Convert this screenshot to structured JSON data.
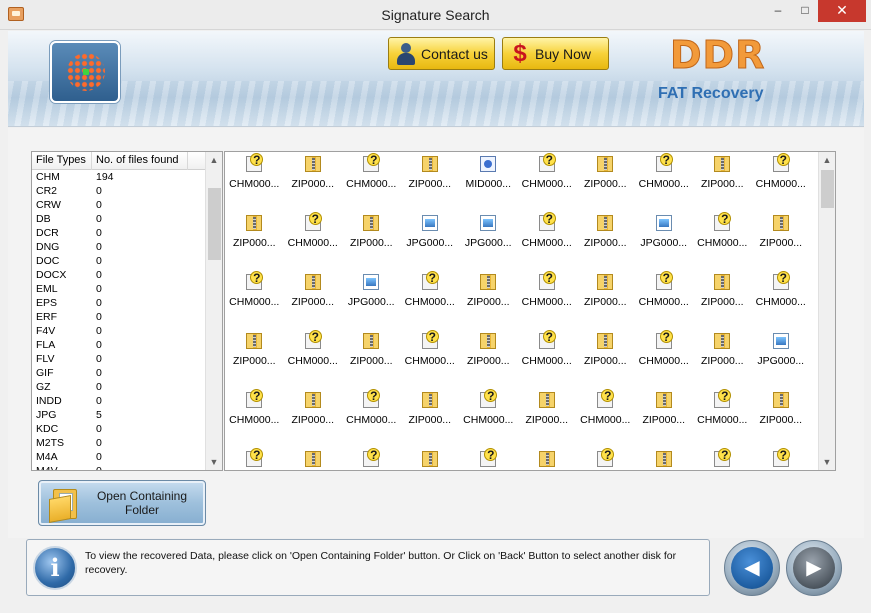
{
  "window": {
    "title": "Signature Search",
    "minimize": "–",
    "maximize": "□",
    "close": "✕"
  },
  "header": {
    "contact_label": "Contact us",
    "buy_label": "Buy  Now",
    "brand": "DDR",
    "brand_sub": "FAT Recovery"
  },
  "types_table": {
    "col1": "File Types",
    "col2": "No. of files found",
    "rows": [
      [
        "CHM",
        "194"
      ],
      [
        "CR2",
        "0"
      ],
      [
        "CRW",
        "0"
      ],
      [
        "DB",
        "0"
      ],
      [
        "DCR",
        "0"
      ],
      [
        "DNG",
        "0"
      ],
      [
        "DOC",
        "0"
      ],
      [
        "DOCX",
        "0"
      ],
      [
        "EML",
        "0"
      ],
      [
        "EPS",
        "0"
      ],
      [
        "ERF",
        "0"
      ],
      [
        "F4V",
        "0"
      ],
      [
        "FLA",
        "0"
      ],
      [
        "FLV",
        "0"
      ],
      [
        "GIF",
        "0"
      ],
      [
        "GZ",
        "0"
      ],
      [
        "INDD",
        "0"
      ],
      [
        "JPG",
        "5"
      ],
      [
        "KDC",
        "0"
      ],
      [
        "M2TS",
        "0"
      ],
      [
        "M4A",
        "0"
      ],
      [
        "M4V",
        "0"
      ]
    ]
  },
  "files": [
    {
      "t": "chm",
      "n": "CHM000..."
    },
    {
      "t": "zip",
      "n": "ZIP000..."
    },
    {
      "t": "chm",
      "n": "CHM000..."
    },
    {
      "t": "zip",
      "n": "ZIP000..."
    },
    {
      "t": "mid",
      "n": "MID000..."
    },
    {
      "t": "chm",
      "n": "CHM000..."
    },
    {
      "t": "zip",
      "n": "ZIP000..."
    },
    {
      "t": "chm",
      "n": "CHM000..."
    },
    {
      "t": "zip",
      "n": "ZIP000..."
    },
    {
      "t": "chm",
      "n": "CHM000..."
    },
    {
      "t": "zip",
      "n": "ZIP000..."
    },
    {
      "t": "chm",
      "n": "CHM000..."
    },
    {
      "t": "zip",
      "n": "ZIP000..."
    },
    {
      "t": "jpg",
      "n": "JPG000..."
    },
    {
      "t": "jpg",
      "n": "JPG000..."
    },
    {
      "t": "chm",
      "n": "CHM000..."
    },
    {
      "t": "zip",
      "n": "ZIP000..."
    },
    {
      "t": "jpg",
      "n": "JPG000..."
    },
    {
      "t": "chm",
      "n": "CHM000..."
    },
    {
      "t": "zip",
      "n": "ZIP000..."
    },
    {
      "t": "chm",
      "n": "CHM000..."
    },
    {
      "t": "zip",
      "n": "ZIP000..."
    },
    {
      "t": "jpg",
      "n": "JPG000..."
    },
    {
      "t": "chm",
      "n": "CHM000..."
    },
    {
      "t": "zip",
      "n": "ZIP000..."
    },
    {
      "t": "chm",
      "n": "CHM000..."
    },
    {
      "t": "zip",
      "n": "ZIP000..."
    },
    {
      "t": "chm",
      "n": "CHM000..."
    },
    {
      "t": "zip",
      "n": "ZIP000..."
    },
    {
      "t": "chm",
      "n": "CHM000..."
    },
    {
      "t": "zip",
      "n": "ZIP000..."
    },
    {
      "t": "chm",
      "n": "CHM000..."
    },
    {
      "t": "zip",
      "n": "ZIP000..."
    },
    {
      "t": "chm",
      "n": "CHM000..."
    },
    {
      "t": "zip",
      "n": "ZIP000..."
    },
    {
      "t": "chm",
      "n": "CHM000..."
    },
    {
      "t": "zip",
      "n": "ZIP000..."
    },
    {
      "t": "chm",
      "n": "CHM000..."
    },
    {
      "t": "zip",
      "n": "ZIP000..."
    },
    {
      "t": "jpg",
      "n": "JPG000..."
    },
    {
      "t": "chm",
      "n": "CHM000..."
    },
    {
      "t": "zip",
      "n": "ZIP000..."
    },
    {
      "t": "chm",
      "n": "CHM000..."
    },
    {
      "t": "zip",
      "n": "ZIP000..."
    },
    {
      "t": "chm",
      "n": "CHM000..."
    },
    {
      "t": "zip",
      "n": "ZIP000..."
    },
    {
      "t": "chm",
      "n": "CHM000..."
    },
    {
      "t": "zip",
      "n": "ZIP000..."
    },
    {
      "t": "chm",
      "n": "CHM000..."
    },
    {
      "t": "zip",
      "n": "ZIP000..."
    },
    {
      "t": "chm",
      "n": ""
    },
    {
      "t": "zip",
      "n": ""
    },
    {
      "t": "chm",
      "n": ""
    },
    {
      "t": "zip",
      "n": ""
    },
    {
      "t": "chm",
      "n": ""
    },
    {
      "t": "zip",
      "n": ""
    },
    {
      "t": "chm",
      "n": ""
    },
    {
      "t": "zip",
      "n": ""
    },
    {
      "t": "chm",
      "n": ""
    },
    {
      "t": "chm",
      "n": ""
    }
  ],
  "open_folder_label": "Open Containing Folder",
  "status": {
    "info_glyph": "i",
    "text": "To view the recovered Data, please click on 'Open Containing Folder' button. Or Click on 'Back' Button to select another disk for recovery."
  },
  "nav": {
    "back_glyph": "◀",
    "next_glyph": "▶"
  },
  "scroll": {
    "up": "▲",
    "down": "▼"
  }
}
